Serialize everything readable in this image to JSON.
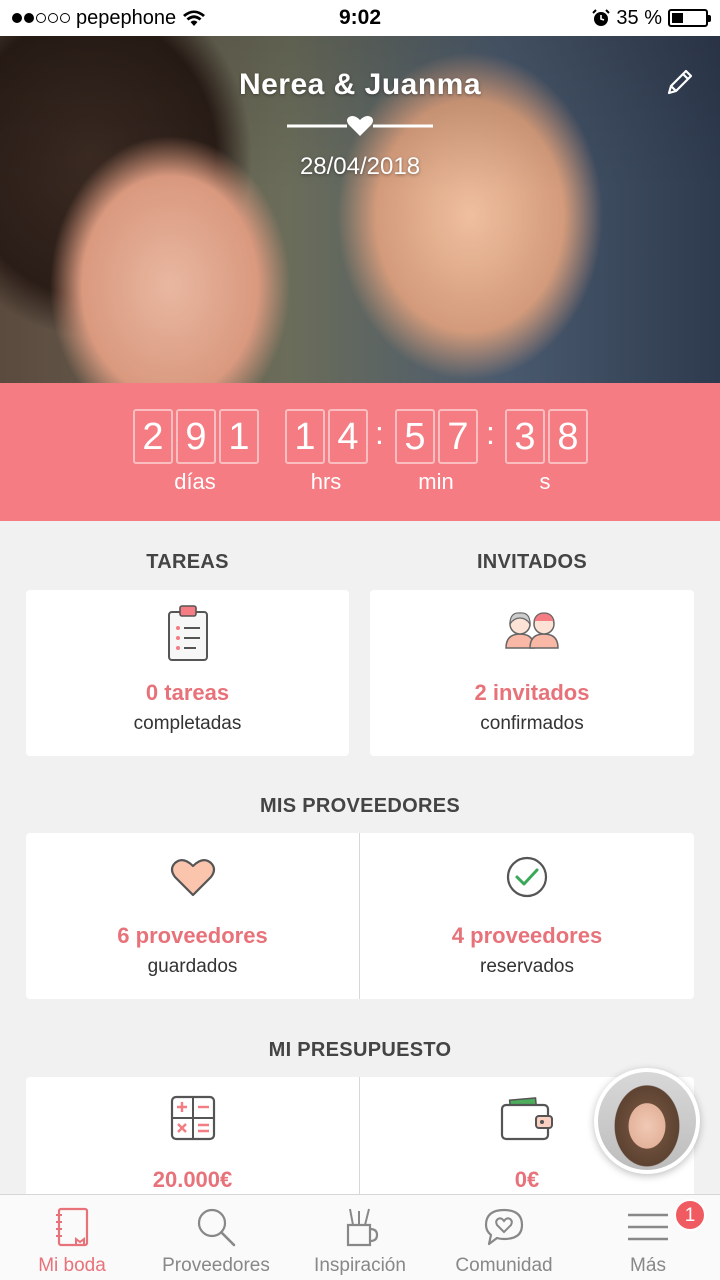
{
  "status_bar": {
    "carrier": "pepephone",
    "time": "9:02",
    "battery_percent": "35 %",
    "battery_level": 0.35
  },
  "header": {
    "couple_names": "Nerea & Juanma",
    "wedding_date": "28/04/2018",
    "edit_icon": "pencil-icon"
  },
  "countdown": {
    "days_digits": [
      "2",
      "9",
      "1"
    ],
    "hours_digits": [
      "1",
      "4"
    ],
    "minutes_digits": [
      "5",
      "7"
    ],
    "seconds_digits": [
      "3",
      "8"
    ],
    "labels": {
      "days": "días",
      "hours": "hrs",
      "minutes": "min",
      "seconds": "s"
    },
    "background_color": "#f47c82"
  },
  "tasks": {
    "title": "TAREAS",
    "value": "0 tareas",
    "subtitle": "completadas",
    "icon": "clipboard-checklist-icon"
  },
  "guests": {
    "title": "INVITADOS",
    "value": "2 invitados",
    "subtitle": "confirmados",
    "icon": "couple-guests-icon"
  },
  "vendors": {
    "title": "MIS PROVEEDORES",
    "saved": {
      "value": "6 proveedores",
      "subtitle": "guardados",
      "icon": "heart-icon"
    },
    "booked": {
      "value": "4 proveedores",
      "subtitle": "reservados",
      "icon": "check-circle-icon"
    }
  },
  "budget": {
    "title": "MI PRESUPUESTO",
    "estimated": {
      "value": "20.000€",
      "icon": "calculator-icon"
    },
    "spent": {
      "value": "0€",
      "icon": "wallet-icon"
    }
  },
  "tab_bar": {
    "items": [
      {
        "label": "Mi boda",
        "icon": "notebook-icon",
        "active": true
      },
      {
        "label": "Proveedores",
        "icon": "search-icon",
        "active": false
      },
      {
        "label": "Inspiración",
        "icon": "pencil-cup-icon",
        "active": false
      },
      {
        "label": "Comunidad",
        "icon": "chat-heart-icon",
        "active": false
      },
      {
        "label": "Más",
        "icon": "menu-icon",
        "active": false,
        "badge": "1"
      }
    ]
  },
  "colors": {
    "accent": "#e8727a",
    "countdown_bg": "#f47c82",
    "badge": "#f05a61",
    "check_green": "#3aa85a"
  }
}
